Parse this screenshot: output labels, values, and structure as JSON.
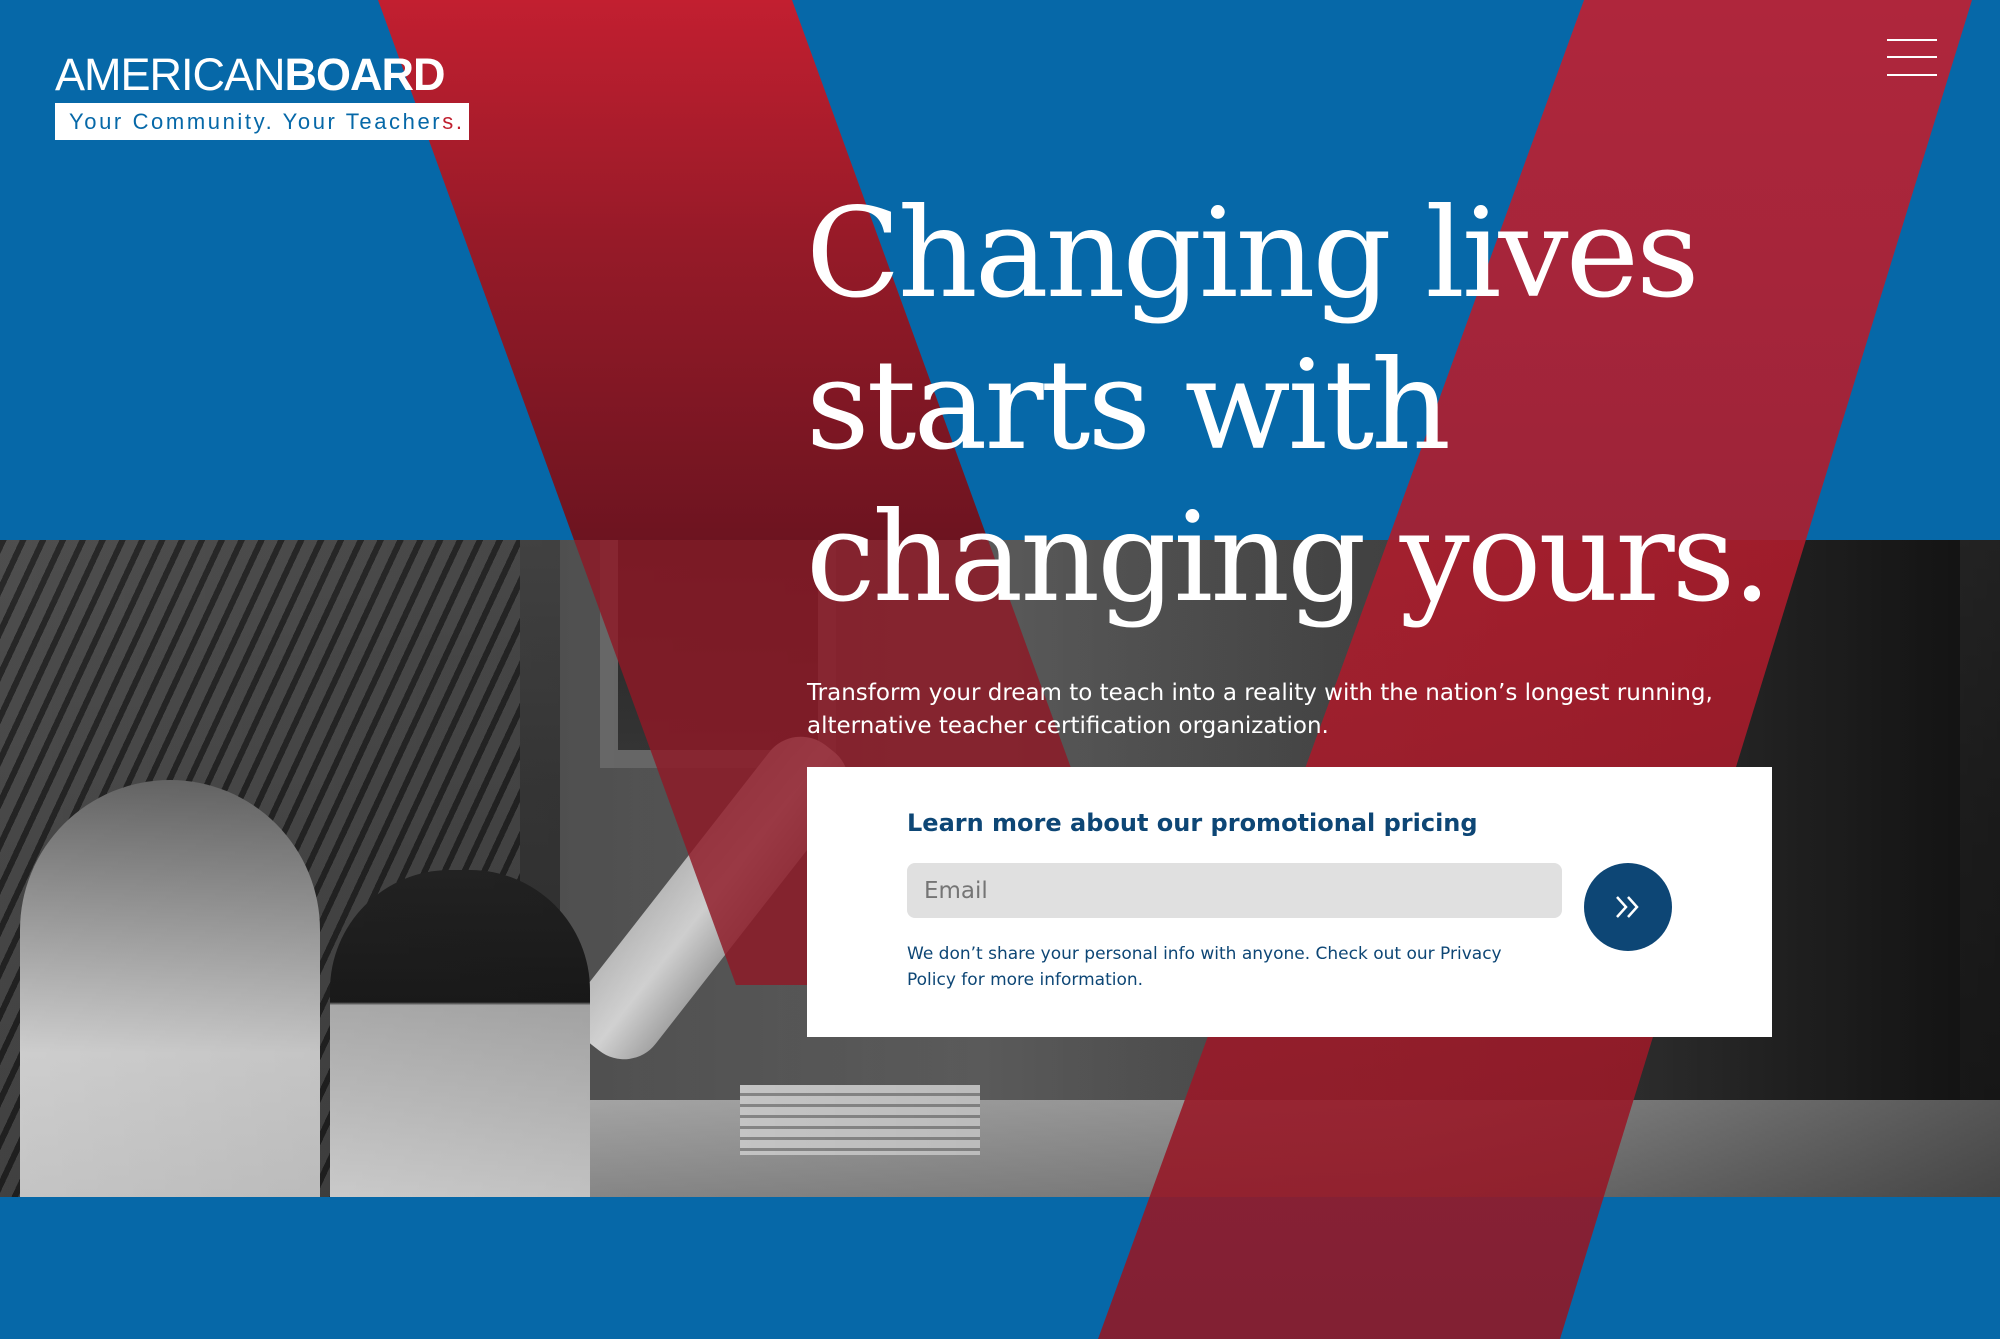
{
  "brand": {
    "logo_word_light": "AMERICAN",
    "logo_word_bold": "BOARD",
    "tagline_main": "Your Community. Your Teacher",
    "tagline_accent": "s.",
    "colors": {
      "blue": "#0668a8",
      "red": "#c0202f",
      "navy": "#0d4675",
      "white": "#ffffff"
    }
  },
  "header": {
    "menu_icon": "hamburger-menu-icon"
  },
  "hero": {
    "headline_lines": [
      "Changing lives",
      "starts with",
      "changing yours."
    ],
    "subtext": "Transform your dream to teach into a reality with the nation’s longest running, alternative teacher certification organization."
  },
  "signup": {
    "title": "Learn more about our promotional pricing",
    "email_placeholder": "Email",
    "email_value": "",
    "submit_icon": "double-chevron-right-icon",
    "disclaimer": "We don’t share your personal info with anyone. Check out our Privacy Policy for more information."
  }
}
